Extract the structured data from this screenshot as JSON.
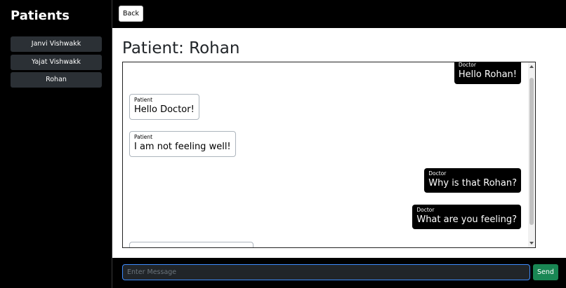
{
  "sidebar": {
    "title": "Patients",
    "items": [
      {
        "label": "Janvi Vishwakk"
      },
      {
        "label": "Yajat Vishwakk"
      },
      {
        "label": "Rohan"
      }
    ]
  },
  "toolbar": {
    "back_label": "Back"
  },
  "main": {
    "title": "Patient: Rohan"
  },
  "messages": [
    {
      "sender": "Doctor",
      "text": "Hello Rohan!"
    },
    {
      "sender": "Patient",
      "text": "Hello Doctor!"
    },
    {
      "sender": "Patient",
      "text": "I am not feeling well!"
    },
    {
      "sender": "Doctor",
      "text": "Why is that Rohan?"
    },
    {
      "sender": "Doctor",
      "text": "What are you feeling?"
    }
  ],
  "composer": {
    "placeholder": "Enter Message",
    "value": "",
    "send_label": "Send"
  },
  "colors": {
    "doctor_bubble": "#000000",
    "patient_bubble": "#ffffff",
    "send": "#198754",
    "focus": "#3d8bfd"
  }
}
